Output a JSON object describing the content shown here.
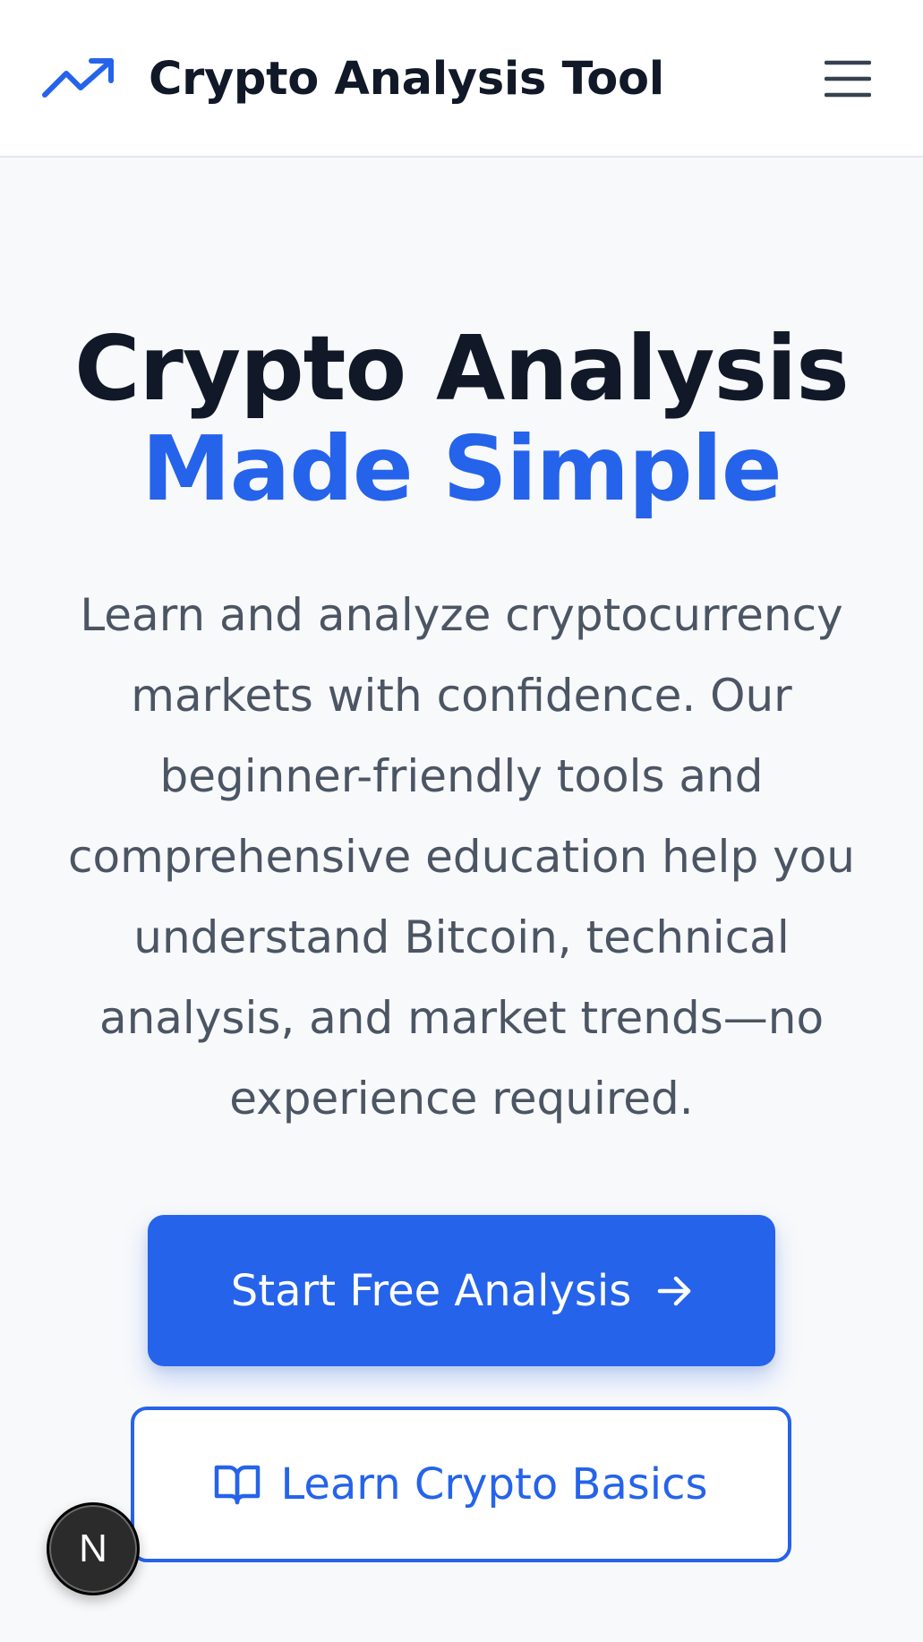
{
  "header": {
    "brand_icon": "trending-up-icon",
    "brand_title": "Crypto Analysis Tool",
    "menu_icon": "hamburger-menu-icon"
  },
  "hero": {
    "title_line1": "Crypto Analysis",
    "title_line2": "Made Simple",
    "description": "Learn and analyze cryptocurrency markets with confidence. Our beginner-friendly tools and comprehensive education help you understand Bitcoin, technical analysis, and market trends—no experience required.",
    "primary_cta": "Start Free Analysis",
    "primary_cta_icon": "arrow-right-icon",
    "secondary_cta": "Learn Crypto Basics",
    "secondary_cta_icon": "book-open-icon"
  },
  "dev_badge": {
    "label": "N"
  },
  "colors": {
    "accent": "#2563eb",
    "heading": "#111827",
    "body_text": "#4b5563",
    "background": "#f8f9fb"
  }
}
